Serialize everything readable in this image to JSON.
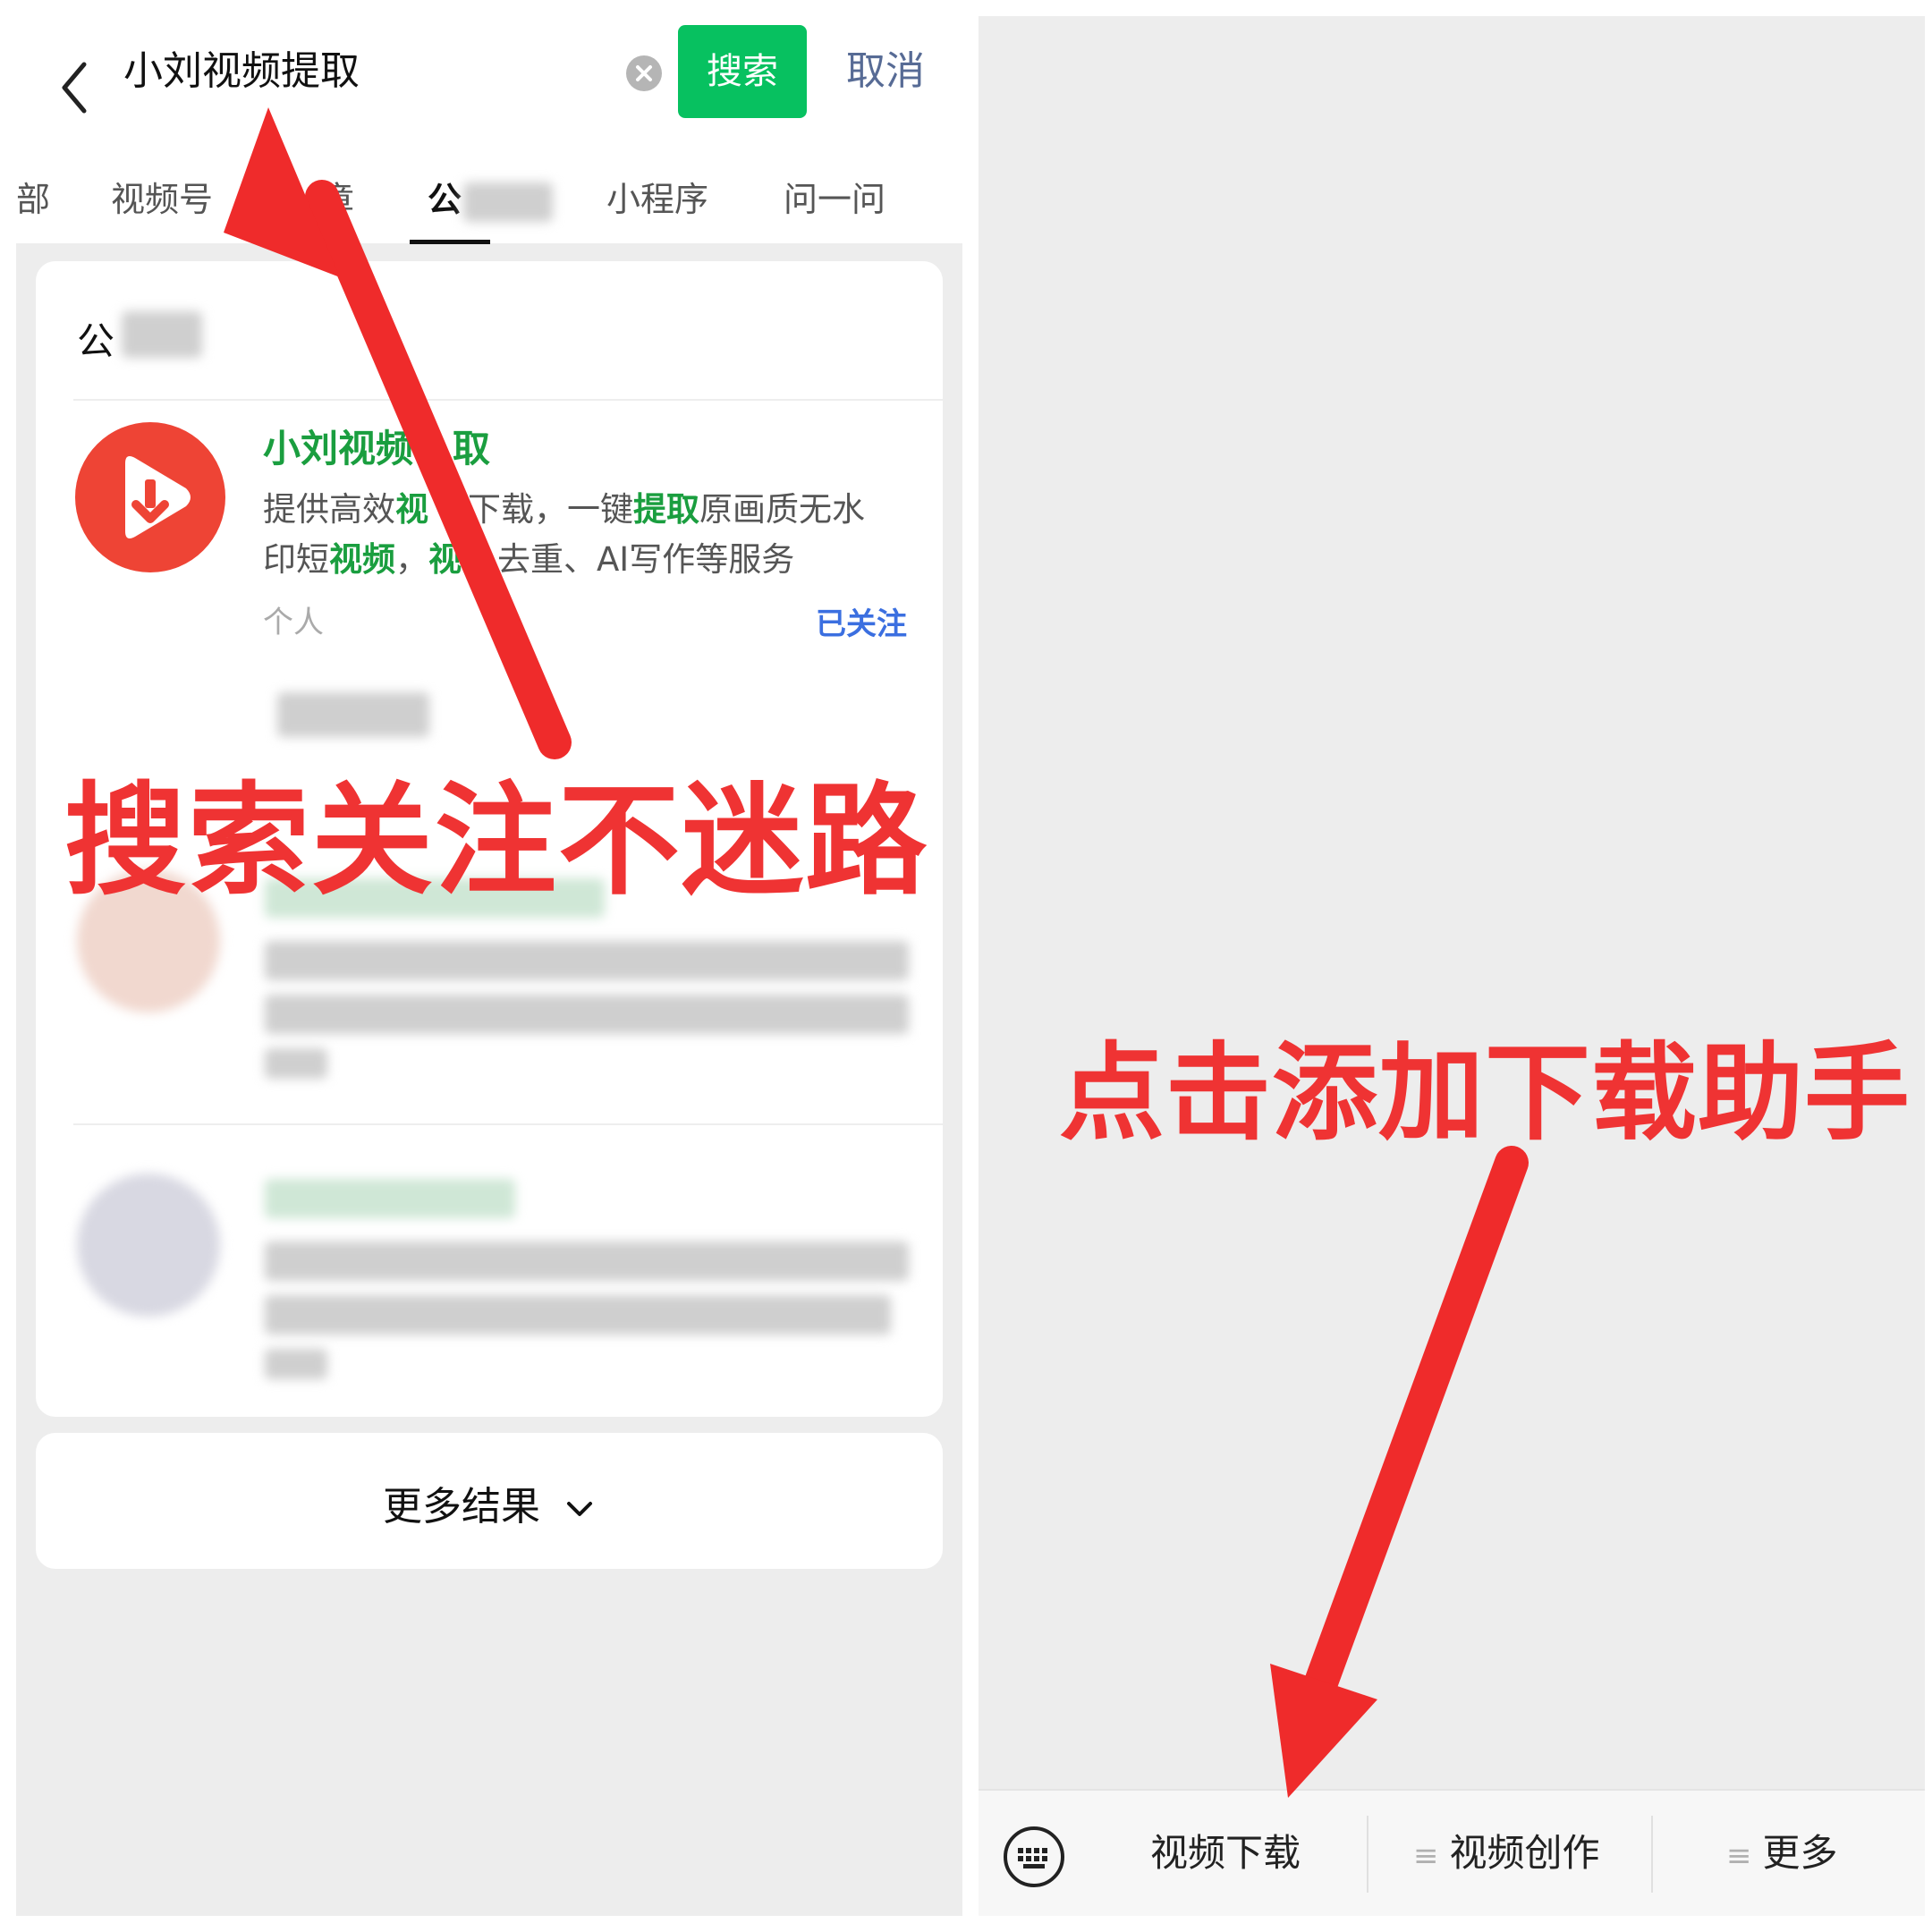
{
  "search": {
    "query": "小刘视频提取",
    "button_label": "搜索",
    "cancel_label": "取消"
  },
  "tabs": {
    "partial_first": "部",
    "items": [
      "视频号",
      "文章",
      "公众号",
      "小程序",
      "问一问"
    ],
    "visible_labels": [
      "视频号",
      "章",
      "公",
      "小程序",
      "问一问"
    ],
    "active_index": 2
  },
  "result_card": {
    "section_title": "公",
    "account": {
      "name": "小刘视频提取",
      "name_visible": "小刘视频",
      "name_tail": "取",
      "description_line1_parts": [
        "提供高效",
        "视",
        "下载，一键",
        "提取",
        "原画质无水"
      ],
      "description_line2_parts": [
        "印短",
        "视频",
        "，",
        "视",
        "去重、AI写作等服务"
      ],
      "type": "个人",
      "follow_status": "已关注",
      "avatar_colors": {
        "outer": "#ee4435",
        "inner": "#ffffff",
        "arrow": "#ee4435"
      }
    }
  },
  "more_results": {
    "label": "更多结果"
  },
  "captions": {
    "left": "搜索关注不迷路",
    "right": "点击添加下载助手"
  },
  "menu_bar": {
    "items": [
      "视频下载",
      "视频创作",
      "更多"
    ]
  },
  "colors": {
    "wechat_green": "#07c160",
    "link_blue": "#576b95",
    "annotation_red": "#ef3333",
    "follow_blue": "#3b6fe0"
  }
}
